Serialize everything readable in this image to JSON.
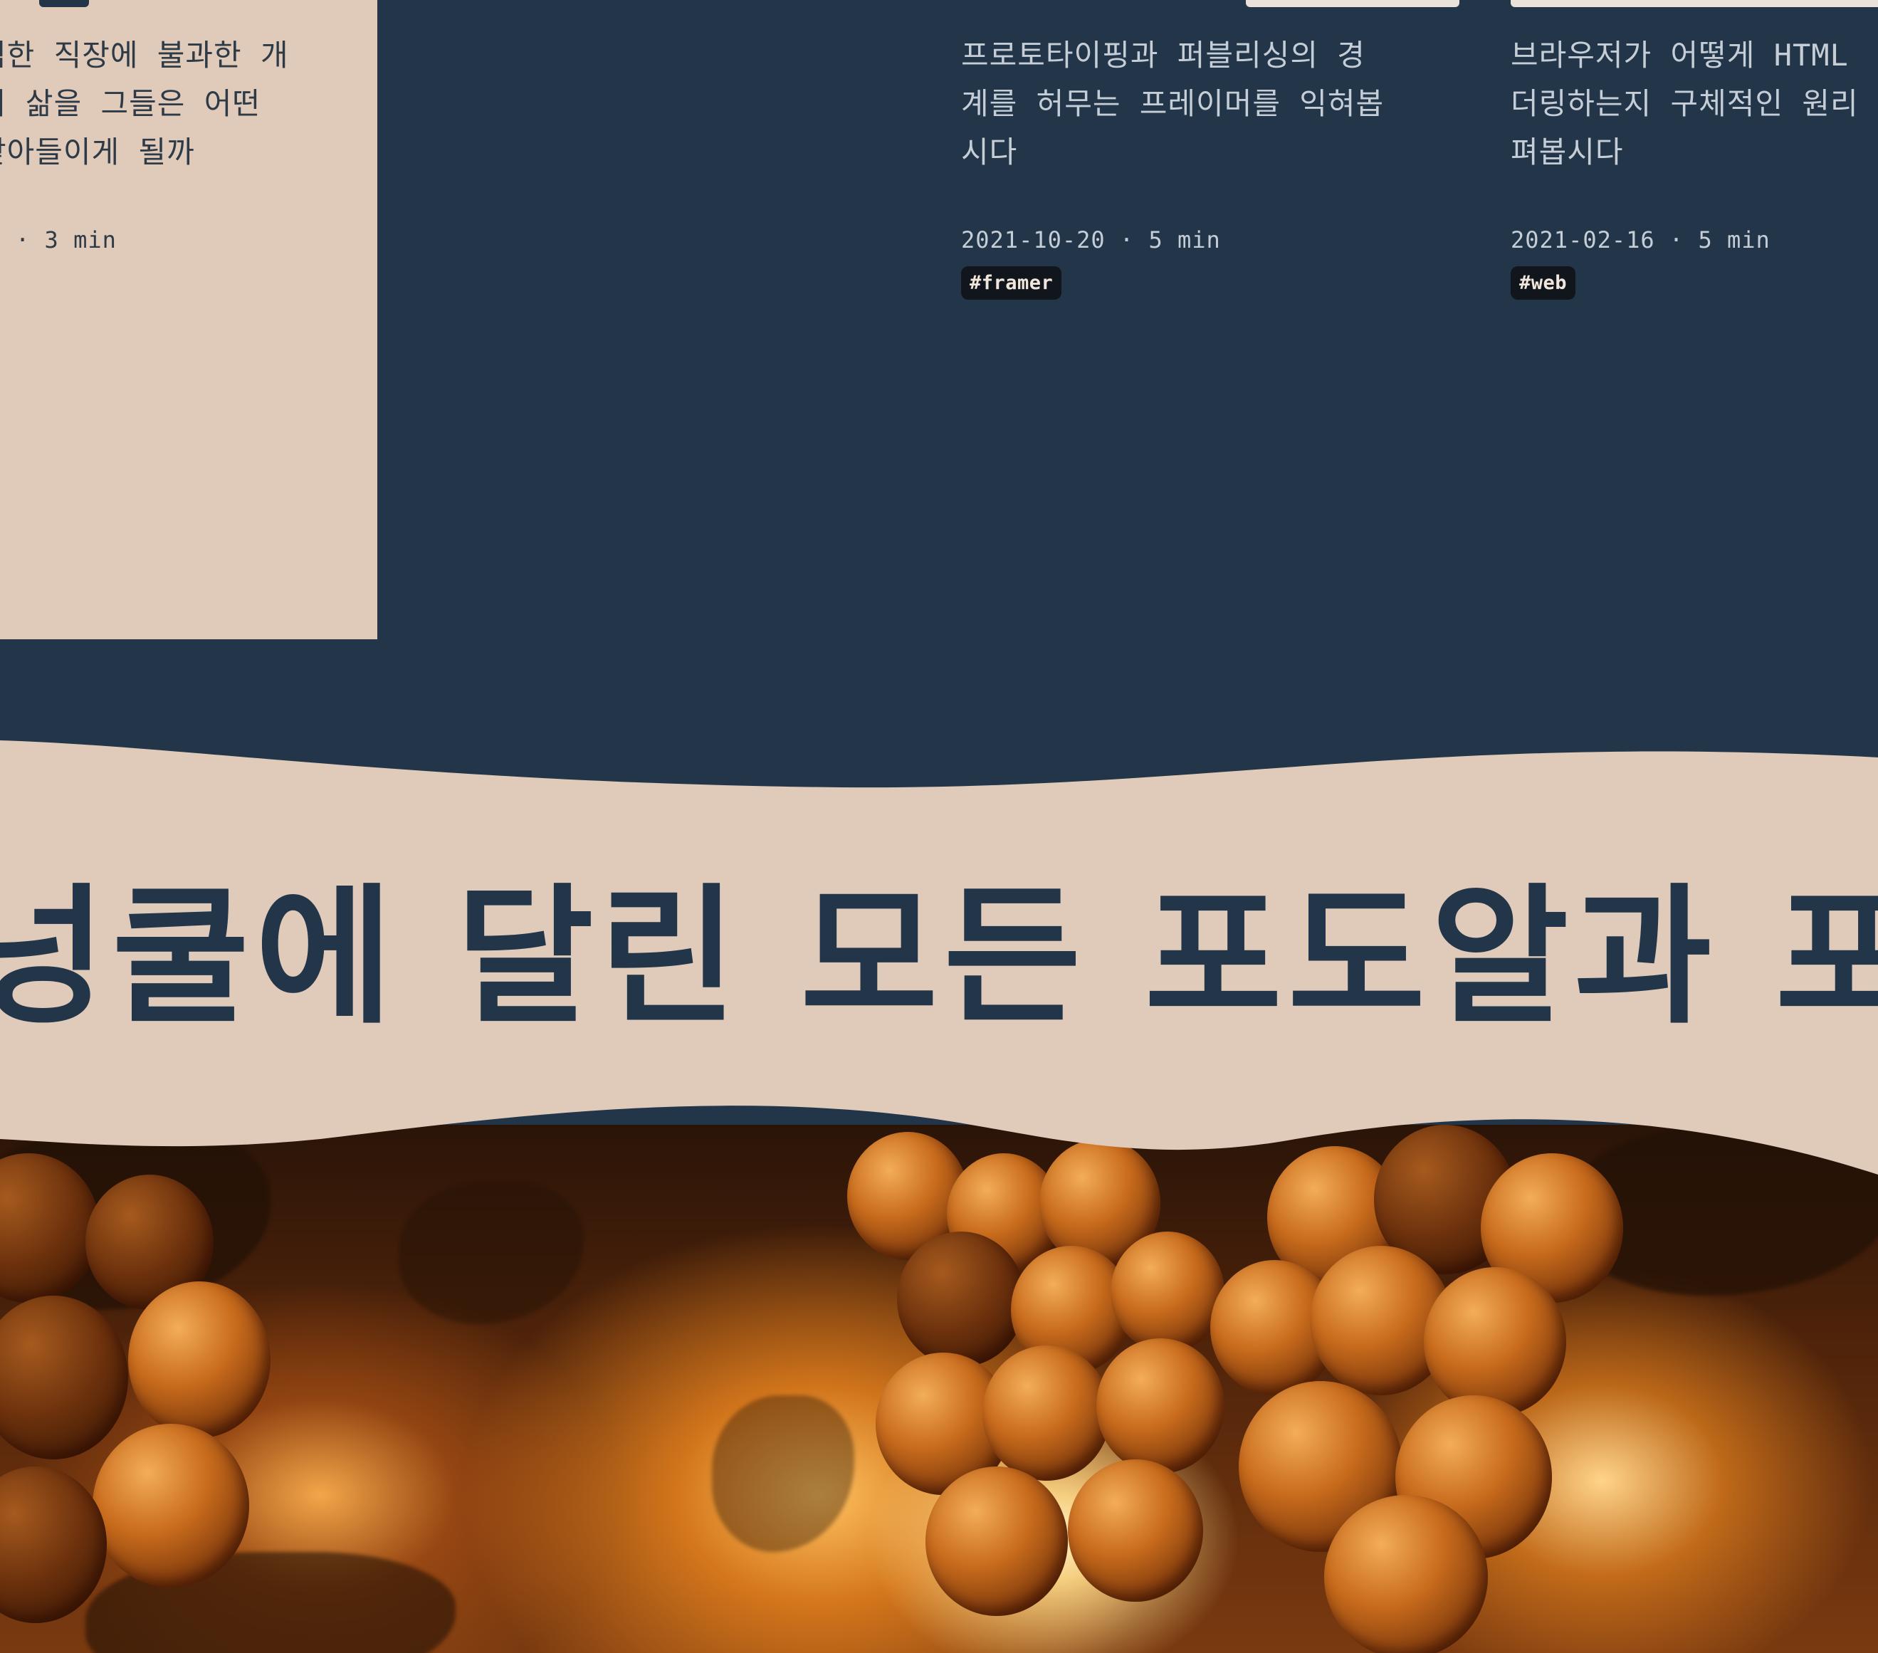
{
  "colors": {
    "navy": "#233649",
    "beige": "#e0cbbb",
    "tag_bg": "#11161c"
  },
  "cards": [
    {
      "id": "left",
      "description": "범한 직장에 불과한 개\n의 삶을 그들은 어떤\n받아들이게 될까",
      "meta": "· 3 min"
    },
    {
      "id": "middle",
      "description": "프로토타이핑과 퍼블리싱의 경\n계를 허무는 프레이머를 익혀봅\n시다",
      "meta": "2021-10-20 · 5 min",
      "tag": "#framer"
    },
    {
      "id": "right",
      "description": "브라우저가 어떻게 HTML\n더링하는지 구체적인 원리\n펴봅시다",
      "meta": "2021-02-16 · 5 min",
      "tag": "#web"
    }
  ],
  "marquee": {
    "text": "넝쿨에 달린 모든 포도알과 포도"
  },
  "hero_image": {
    "icon": "grapes-photo"
  }
}
